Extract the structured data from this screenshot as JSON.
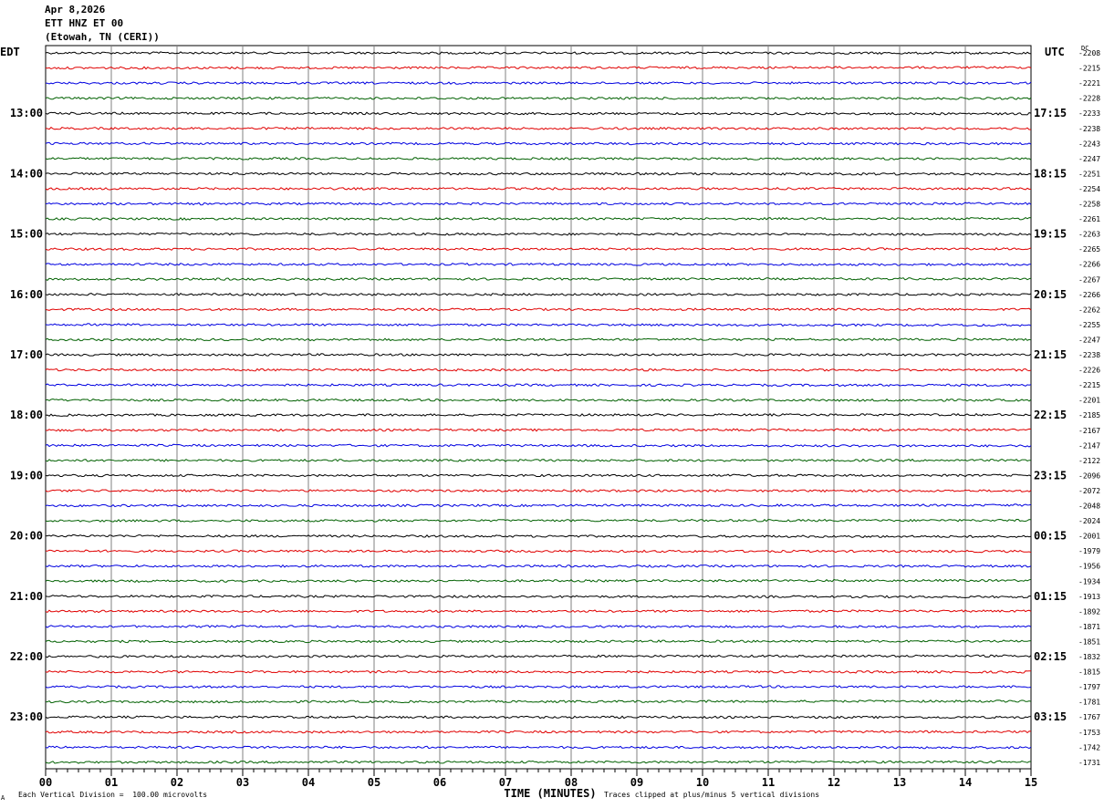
{
  "header": {
    "date": "Apr 8,2026",
    "station": "ETT HNZ ET 00",
    "location": "(Etowah, TN (CERI))"
  },
  "left_tz": "EDT",
  "right_tz": "UTC",
  "dc_label": "DC",
  "footer": {
    "scale": "Each Vertical Division =  100.00 microvolts",
    "clip": "Traces clipped at plus/minus 5 vertical divisions",
    "corner": "A"
  },
  "chart_data": {
    "type": "line",
    "xlabel": "TIME (MINUTES)",
    "xlim": [
      0,
      15
    ],
    "x_ticks": [
      "00",
      "01",
      "02",
      "03",
      "04",
      "05",
      "06",
      "07",
      "08",
      "09",
      "10",
      "11",
      "12",
      "13",
      "14",
      "15"
    ],
    "trace_colors": [
      "#000000",
      "#e00000",
      "#0000e0",
      "#006000"
    ],
    "edt_hour_labels": [
      "13:00",
      "14:00",
      "15:00",
      "16:00",
      "17:00",
      "18:00",
      "19:00",
      "20:00",
      "21:00",
      "22:00",
      "23:00"
    ],
    "utc_labels": [
      "17:15",
      "18:15",
      "19:15",
      "20:15",
      "21:15",
      "22:15",
      "23:15",
      "00:15",
      "01:15",
      "02:15",
      "03:15"
    ],
    "hour_label_first_trace": 4,
    "trace_count": 48,
    "dc_offsets": [
      "-2208",
      "-2215",
      "-2221",
      "-2228",
      "-2233",
      "-2238",
      "-2243",
      "-2247",
      "-2251",
      "-2254",
      "-2258",
      "-2261",
      "-2263",
      "-2265",
      "-2266",
      "-2267",
      "-2266",
      "-2262",
      "-2255",
      "-2247",
      "-2238",
      "-2226",
      "-2215",
      "-2201",
      "-2185",
      "-2167",
      "-2147",
      "-2122",
      "-2096",
      "-2072",
      "-2048",
      "-2024",
      "-2001",
      "-1979",
      "-1956",
      "-1934",
      "-1913",
      "-1892",
      "-1871",
      "-1851",
      "-1832",
      "-1815",
      "-1797",
      "-1781",
      "-1767",
      "-1753",
      "-1742",
      "-1731"
    ]
  }
}
